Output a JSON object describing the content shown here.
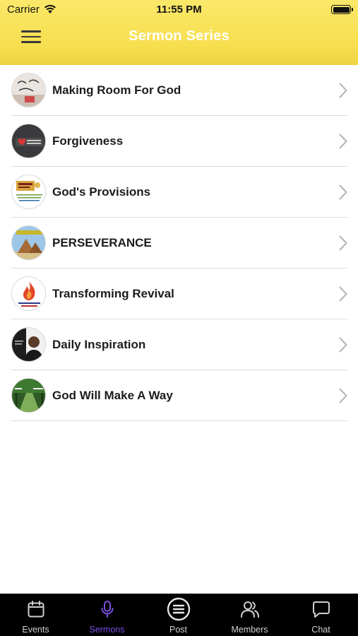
{
  "status_bar": {
    "carrier": "Carrier",
    "time": "11:55 PM"
  },
  "header": {
    "title": "Sermon Series",
    "menu_icon": "hamburger-menu-icon"
  },
  "colors": {
    "header_yellow": "#f7df4f",
    "title_text": "#ffffff",
    "tab_active": "#7a4fe0",
    "tab_inactive": "#cfcfcf",
    "tab_background": "#000000"
  },
  "sermons": [
    {
      "title": "Making Room For God",
      "thumbnail": "room-for-god-thumbnail"
    },
    {
      "title": "Forgiveness",
      "thumbnail": "forgive-thumbnail"
    },
    {
      "title": "God's Provisions",
      "thumbnail": "gods-provisions-thumbnail"
    },
    {
      "title": "PERSEVERANCE",
      "thumbnail": "pyramids-thumbnail"
    },
    {
      "title": "Transforming Revival",
      "thumbnail": "flame-revival-thumbnail"
    },
    {
      "title": "Daily Inspiration",
      "thumbnail": "speaker-portrait-thumbnail"
    },
    {
      "title": "God Will Make A Way",
      "thumbnail": "forest-path-thumbnail"
    }
  ],
  "tabs": [
    {
      "label": "Events",
      "icon": "calendar-icon",
      "active": false
    },
    {
      "label": "Sermons",
      "icon": "microphone-icon",
      "active": true
    },
    {
      "label": "Post",
      "icon": "post-list-icon",
      "active": false
    },
    {
      "label": "Members",
      "icon": "members-icon",
      "active": false
    },
    {
      "label": "Chat",
      "icon": "chat-bubble-icon",
      "active": false
    }
  ]
}
